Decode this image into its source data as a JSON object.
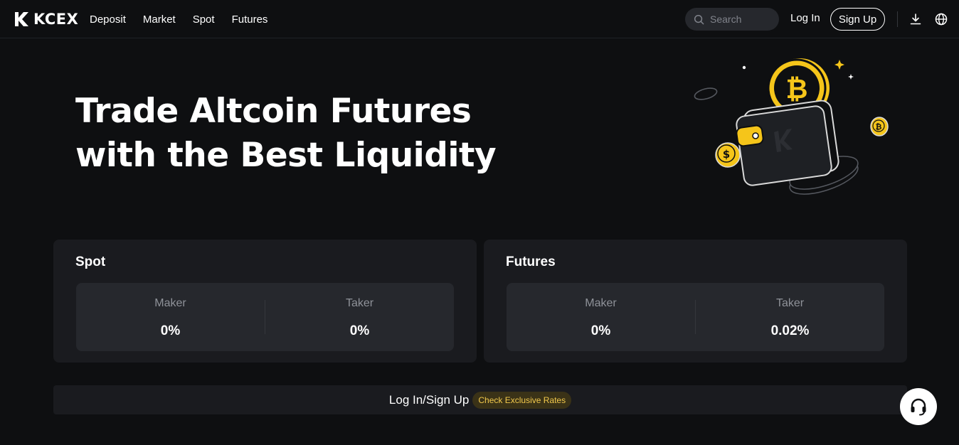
{
  "brand": {
    "name": "KCEX",
    "accent": "#f5c51a"
  },
  "nav": {
    "items": [
      {
        "label": "Deposit"
      },
      {
        "label": "Market"
      },
      {
        "label": "Spot"
      },
      {
        "label": "Futures"
      }
    ]
  },
  "search": {
    "placeholder": "Search",
    "icon": "search-icon"
  },
  "auth": {
    "login_label": "Log In",
    "signup_label": "Sign Up"
  },
  "header_icons": [
    "download-icon",
    "globe-icon"
  ],
  "hero": {
    "title_line1": "Trade Altcoin Futures",
    "title_line2": "with the Best Liquidity"
  },
  "fees": {
    "spot": {
      "title": "Spot",
      "maker_label": "Maker",
      "maker_value": "0%",
      "taker_label": "Taker",
      "taker_value": "0%"
    },
    "futures": {
      "title": "Futures",
      "maker_label": "Maker",
      "maker_value": "0%",
      "taker_label": "Taker",
      "taker_value": "0.02%"
    }
  },
  "banner": {
    "link_label": "Log In/Sign Up",
    "badge_label": "Check Exclusive Rates"
  },
  "support": {
    "icon": "headset-icon"
  }
}
